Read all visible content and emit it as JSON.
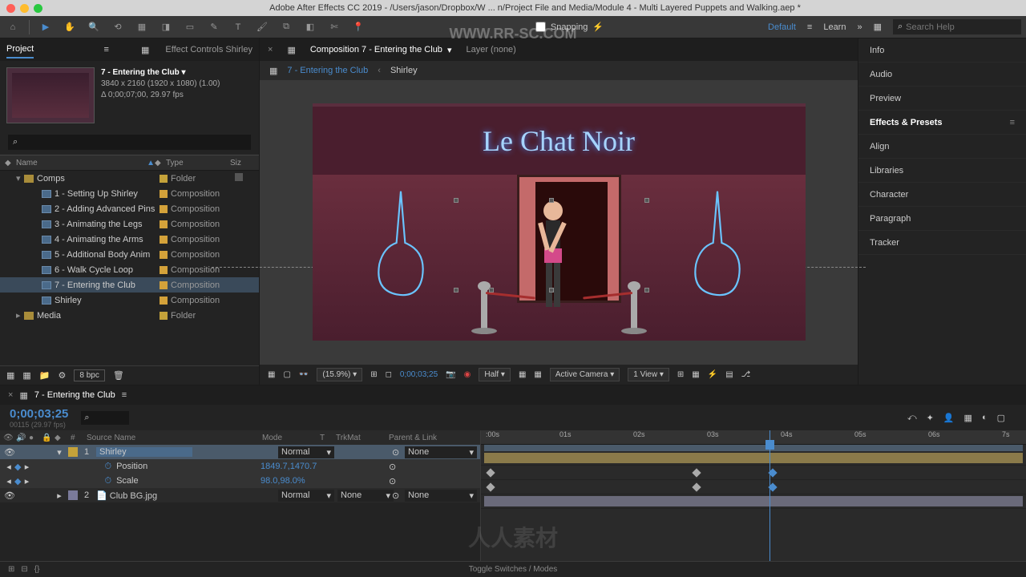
{
  "title": "Adobe After Effects CC 2019 - /Users/jason/Dropbox/W ... n/Project File and Media/Module 4 - Multi Layered Puppets and Walking.aep *",
  "toolbar": {
    "snapping": "Snapping",
    "workspace": "Default",
    "learn": "Learn",
    "search_placeholder": "Search Help"
  },
  "project": {
    "tab_project": "Project",
    "tab_effect_controls": "Effect Controls Shirley",
    "active_comp": {
      "name": "7 - Entering the Club ▾",
      "dims": "3840 x 2160  (1920 x 1080) (1.00)",
      "duration": "Δ 0;00;07;00, 29.97 fps"
    },
    "columns": {
      "name": "Name",
      "type": "Type",
      "size": "Siz"
    },
    "bpc": "8 bpc",
    "tree": [
      {
        "indent": 0,
        "kind": "folder",
        "open": true,
        "label": "Comps",
        "type": "Folder",
        "sizeicon": true
      },
      {
        "indent": 1,
        "kind": "comp",
        "label": "1 - Setting Up Shirley",
        "type": "Composition"
      },
      {
        "indent": 1,
        "kind": "comp",
        "label": "2 - Adding Advanced Pins",
        "type": "Composition"
      },
      {
        "indent": 1,
        "kind": "comp",
        "label": "3 - Animating the Legs",
        "type": "Composition"
      },
      {
        "indent": 1,
        "kind": "comp",
        "label": "4 - Animating the Arms",
        "type": "Composition"
      },
      {
        "indent": 1,
        "kind": "comp",
        "label": "5 - Additional Body Anim",
        "type": "Composition"
      },
      {
        "indent": 1,
        "kind": "comp",
        "label": "6 - Walk Cycle Loop",
        "type": "Composition"
      },
      {
        "indent": 1,
        "kind": "comp",
        "label": "7 - Entering the Club",
        "type": "Composition",
        "selected": true
      },
      {
        "indent": 1,
        "kind": "comp",
        "label": "Shirley",
        "type": "Composition"
      },
      {
        "indent": 0,
        "kind": "folder",
        "open": false,
        "label": "Media",
        "type": "Folder"
      }
    ]
  },
  "composition": {
    "tab_active": "Composition 7 - Entering the Club",
    "tab_layer": "Layer (none)",
    "breadcrumb": [
      "7 - Entering the Club",
      "Shirley"
    ],
    "sign_text": "Le Chat Noir",
    "zoom": "(15.9%)",
    "time": "0;00;03;25",
    "resolution": "Half",
    "camera": "Active Camera",
    "view": "1 View"
  },
  "right_panels": [
    "Info",
    "Audio",
    "Preview",
    "Effects & Presets",
    "Align",
    "Libraries",
    "Character",
    "Paragraph",
    "Tracker"
  ],
  "right_active": "Effects & Presets",
  "timeline": {
    "tab": "7 - Entering the Club",
    "timecode": "0;00;03;25",
    "frame": "00115 (29.97 fps)",
    "columns": {
      "source": "Source Name",
      "mode": "Mode",
      "t": "T",
      "trkmat": "TrkMat",
      "parent": "Parent & Link"
    },
    "layers": [
      {
        "num": "1",
        "name": "Shirley",
        "mode": "Normal",
        "parent": "None",
        "selected": true,
        "kind": "comp",
        "props": [
          {
            "name": "Position",
            "value": "1849.7,1470.7"
          },
          {
            "name": "Scale",
            "value": "98.0,98.0%"
          }
        ]
      },
      {
        "num": "2",
        "name": "Club BG.jpg",
        "mode": "Normal",
        "trkmat": "None",
        "parent": "None",
        "kind": "image"
      }
    ],
    "ruler": [
      ":00s",
      "01s",
      "02s",
      "03s",
      "04s",
      "05s",
      "06s",
      "7s"
    ],
    "footer": "Toggle Switches / Modes",
    "keyframes": {
      "position": [
        8,
        265,
        360
      ],
      "scale": [
        8,
        265,
        360
      ]
    }
  },
  "watermark": "人人素材",
  "watermark_url": "WWW.RR-SC.COM"
}
